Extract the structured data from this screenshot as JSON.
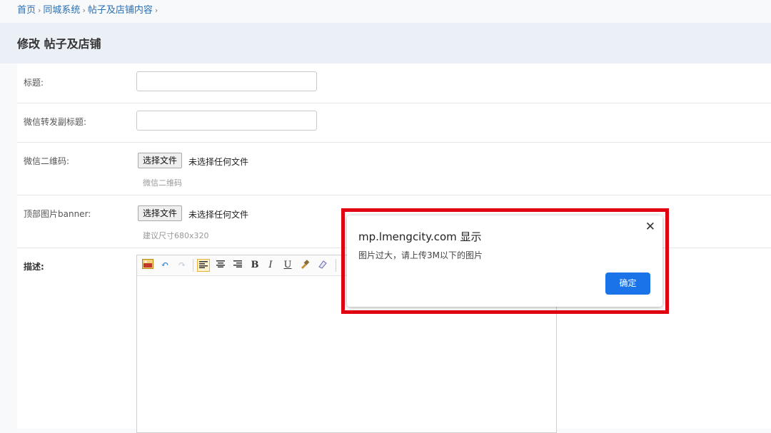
{
  "breadcrumb": {
    "items": [
      "首页",
      "同城系统",
      "帖子及店铺内容"
    ],
    "separator": "›"
  },
  "page_title": "修改 帖子及店铺",
  "form": {
    "title_label": "标题:",
    "title_value": "",
    "subtitle_label": "微信转发副标题:",
    "subtitle_value": "",
    "qrcode_label": "微信二维码:",
    "qrcode_button": "选择文件",
    "qrcode_status": "未选择任何文件",
    "qrcode_hint": "微信二维码",
    "banner_label": "顶部图片banner:",
    "banner_button": "选择文件",
    "banner_status": "未选择任何文件",
    "banner_hint": "建议尺寸680x320",
    "description_label": "描述:"
  },
  "editor_toolbar": {
    "icons": [
      "image-icon",
      "undo-icon",
      "redo-icon",
      "align-left-icon",
      "align-center-icon",
      "align-right-icon",
      "bold-icon",
      "italic-icon",
      "underline-icon",
      "format-brush-icon",
      "eraser-icon"
    ],
    "bold_label": "B",
    "italic_label": "I",
    "underline_label": "U"
  },
  "dialog": {
    "title": "mp.lmengcity.com 显示",
    "message": "图片过大，请上传3M以下的图片",
    "ok_label": "确定",
    "close_label": "✕"
  },
  "colors": {
    "link": "#2b6fb1",
    "title_bar": "#eaf0f6",
    "dialog_button": "#1a73e8",
    "highlight": "#e00010"
  }
}
